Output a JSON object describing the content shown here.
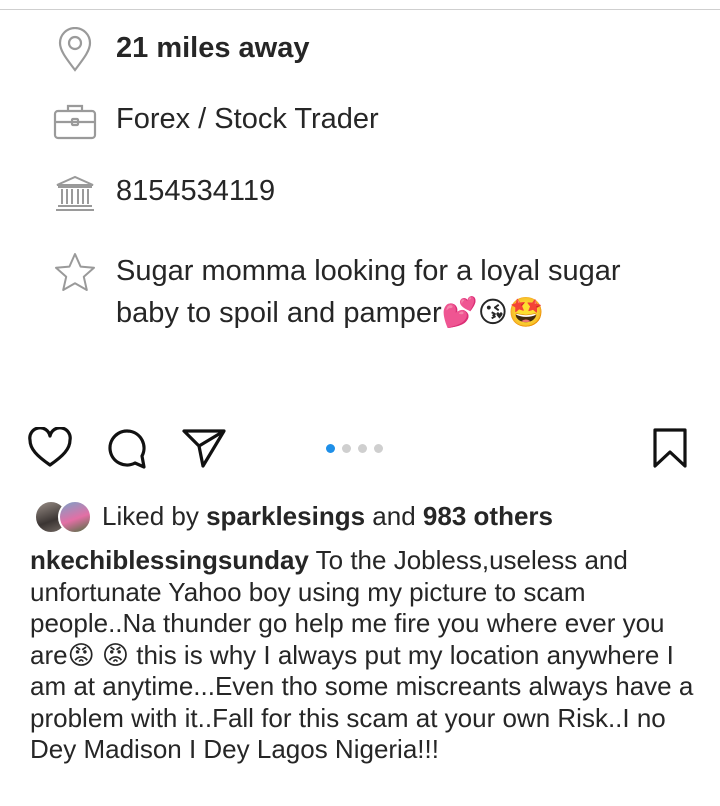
{
  "profile_card": {
    "location_icon": "map-pin-icon",
    "location": "21 miles away",
    "job_icon": "briefcase-icon",
    "job": "Forex / Stock Trader",
    "bank_icon": "bank-icon",
    "bank": "8154534119",
    "bio_icon": "star-icon",
    "bio": "Sugar momma looking for a loyal sugar baby to spoil and pamper💕😘🤩"
  },
  "actions": {
    "like_icon": "heart-icon",
    "comment_icon": "comment-icon",
    "share_icon": "send-icon",
    "save_icon": "bookmark-icon"
  },
  "carousel": {
    "count": 4,
    "active_index": 0,
    "active_color": "#1e8fe8"
  },
  "likes": {
    "prefix": "Liked by",
    "user": "sparklesings",
    "and": "and",
    "others": "983 others"
  },
  "caption": {
    "username": "nkechiblessingsunday",
    "text": "To the Jobless,useless and unfortunate Yahoo boy using my picture to scam people..Na thunder go help me fire you where ever you are😡 😡  this is why I always put my location anywhere I am at anytime...Even tho some miscreants always have a problem with it..Fall for this scam at your own Risk..I no Dey Madison I Dey Lagos Nigeria!!!"
  }
}
